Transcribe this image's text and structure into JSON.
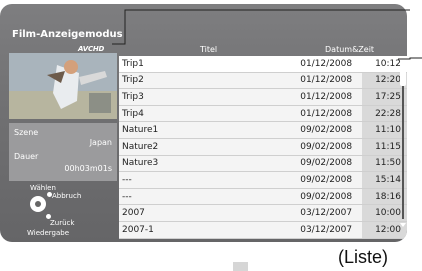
{
  "screen": {
    "title": "Film-Anzeigemodus",
    "format_logo": "AVCHD",
    "columns": {
      "title": "Titel",
      "datetime": "Datum&Zeit"
    }
  },
  "info": {
    "scene_label": "Szene",
    "scene_value": "Japan",
    "duration_label": "Dauer",
    "duration_value": "00h03m01s"
  },
  "controls": {
    "select": "Wählen",
    "cancel": "Abbruch",
    "back": "Zurück",
    "play": "Wiedergabe"
  },
  "rows": [
    {
      "title": "Trip1",
      "date": "01/12/2008",
      "time": "10:12",
      "selected": true
    },
    {
      "title": "Trip2",
      "date": "01/12/2008",
      "time": "12:20"
    },
    {
      "title": "Trip3",
      "date": "01/12/2008",
      "time": "17:25"
    },
    {
      "title": "Trip4",
      "date": "01/12/2008",
      "time": "22:28"
    },
    {
      "title": "Nature1",
      "date": "09/02/2008",
      "time": "11:10"
    },
    {
      "title": "Nature2",
      "date": "09/02/2008",
      "time": "11:15"
    },
    {
      "title": "Nature3",
      "date": "09/02/2008",
      "time": "11:50"
    },
    {
      "title": "---",
      "date": "09/02/2008",
      "time": "15:14"
    },
    {
      "title": "---",
      "date": "09/02/2008",
      "time": "18:16"
    },
    {
      "title": "2007",
      "date": "03/12/2007",
      "time": "10:00"
    },
    {
      "title": "2007-1",
      "date": "03/12/2007",
      "time": "12:00"
    }
  ],
  "caption": "(Liste)",
  "colors": {
    "background": "#757577",
    "panel": "#9b9b9d",
    "row": "#f4f4f4",
    "time_cell": "#d9d9d9"
  },
  "icons": {
    "navigation_pad": "circle-pad-icon",
    "scrollbar_arrows": "triangle-arrow-icon"
  }
}
